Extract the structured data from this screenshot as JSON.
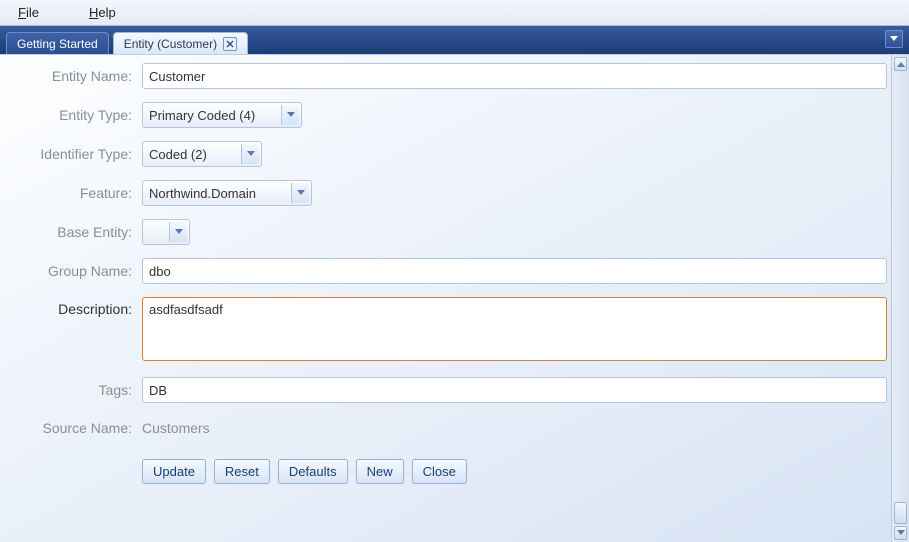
{
  "menu": {
    "file": "File",
    "help": "Help"
  },
  "tabs": {
    "inactive": "Getting Started",
    "active": "Entity (Customer)"
  },
  "form": {
    "labels": {
      "entity_name": "Entity Name:",
      "entity_type": "Entity Type:",
      "identifier_type": "Identifier Type:",
      "feature": "Feature:",
      "base_entity": "Base Entity:",
      "group_name": "Group Name:",
      "description": "Description:",
      "tags": "Tags:",
      "source_name": "Source Name:"
    },
    "values": {
      "entity_name": "Customer",
      "entity_type": "Primary Coded (4)",
      "identifier_type": "Coded (2)",
      "feature": "Northwind.Domain",
      "base_entity": "",
      "group_name": "dbo",
      "description": "asdfasdfsadf",
      "tags": "DB",
      "source_name": "Customers"
    }
  },
  "buttons": {
    "update": "Update",
    "reset": "Reset",
    "defaults": "Defaults",
    "new": "New",
    "close": "Close"
  }
}
